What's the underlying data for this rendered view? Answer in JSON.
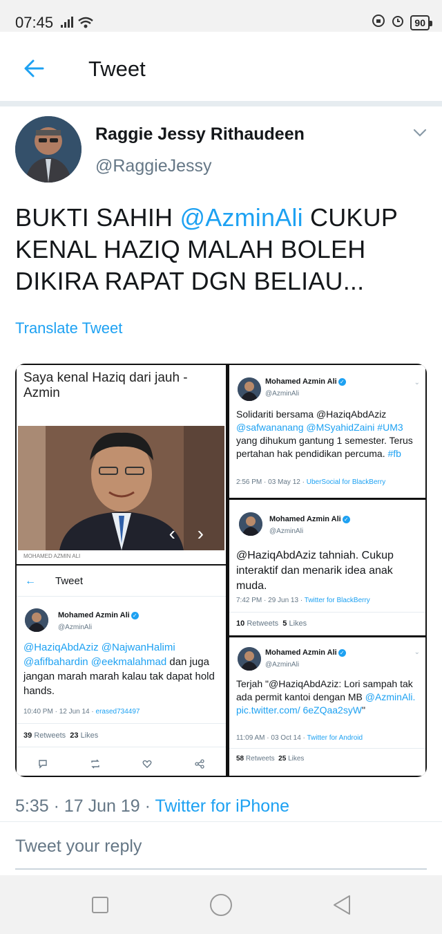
{
  "status_bar": {
    "time": "07:45",
    "battery": "90"
  },
  "app_bar": {
    "title": "Tweet"
  },
  "tweet": {
    "author_name": "Raggie Jessy Rithaudeen",
    "author_handle": "@RaggieJessy",
    "text_before": "BUKTI SAHIH ",
    "mention": "@AzminAli",
    "text_after": " CUKUP KENAL HAZIQ MALAH BOLEH DIKIRA RAPAT DGN BELIAU...",
    "translate_label": "Translate Tweet",
    "time": "5:35 · 17 Jun 19 · ",
    "source": "Twitter for iPhone"
  },
  "collage": {
    "news": {
      "headline": "Saya kenal Haziq dari jauh - Azmin",
      "caption": "MOHAMED AZMIN ALI",
      "arrows": "‹ ›"
    },
    "tweet_a": {
      "name": "Mohamed Azmin Ali",
      "handle": "@AzminAli",
      "text_1": "Solidariti bersama @HaziqAbdAziz",
      "text_link": "@safwananang @MSyahidZaini #UM3",
      "text_2": "yang dihukum gantung 1 semester. Terus pertahan hak pendidikan percuma. ",
      "hashtag": "#fb",
      "meta": "2:56 PM · 03 May 12 · ",
      "source": "UberSocial for BlackBerry"
    },
    "tweet_b": {
      "back": "←",
      "screen_title": "Tweet",
      "name": "Mohamed Azmin Ali",
      "handle": "@AzminAli",
      "text_links": "@HaziqAbdAziz @NajwanHalimi @afifbahardin @eekmalahmad",
      "text_rest": " dan juga jangan marah marah kalau tak dapat hold hands.",
      "meta": "10:40 PM · 12 Jun 14 · ",
      "source": "erased734497",
      "retweets_num": "39",
      "retweets_label": "Retweets",
      "likes_num": "23",
      "likes_label": "Likes"
    },
    "tweet_c": {
      "name": "Mohamed Azmin Ali",
      "handle": "@AzminAli",
      "text": "@HaziqAbdAziz tahniah. Cukup interaktif dan menarik idea anak muda.",
      "meta": "7:42 PM · 29 Jun 13 · ",
      "source": "Twitter for BlackBerry",
      "retweets_num": "10",
      "retweets_label": "Retweets",
      "likes_num": "5",
      "likes_label": "Likes"
    },
    "tweet_d": {
      "name": "Mohamed Azmin Ali",
      "handle": "@AzminAli",
      "text_1": "Terjah \"@HaziqAbdAziz: Lori sampah tak ada permit kantoi dengan MB ",
      "text_link": "@AzminAli. pic.twitter.com/ 6eZQaa2syW",
      "text_2": "\"",
      "meta": "11:09 AM · 03 Oct 14 · ",
      "source": "Twitter for Android",
      "retweets_num": "58",
      "retweets_label": "Retweets",
      "likes_num": "25",
      "likes_label": "Likes"
    }
  },
  "reply": {
    "placeholder": "Tweet your reply"
  },
  "colors": {
    "accent": "#1da1f2",
    "secondary_text": "#657786",
    "primary_text": "#14171a"
  }
}
